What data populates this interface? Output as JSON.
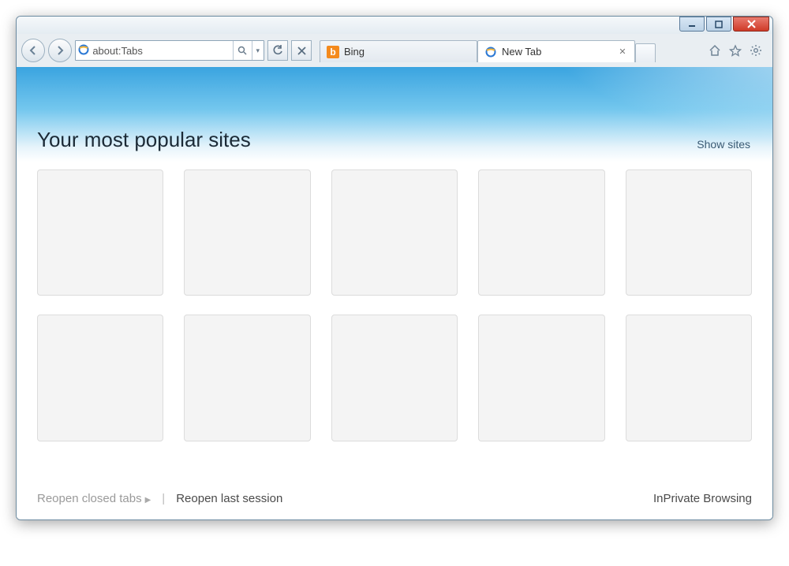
{
  "address_bar": {
    "url": "about:Tabs"
  },
  "tabs": [
    {
      "label": "Bing",
      "favicon": "bing",
      "active": false,
      "closeable": false
    },
    {
      "label": "New Tab",
      "favicon": "ie",
      "active": true,
      "closeable": true
    }
  ],
  "page": {
    "heading": "Your most popular sites",
    "show_sites_label": "Show sites"
  },
  "tiles": {
    "count": 10
  },
  "footer": {
    "reopen_closed_label": "Reopen closed tabs",
    "reopen_session_label": "Reopen last session",
    "inprivate_label": "InPrivate Browsing"
  }
}
